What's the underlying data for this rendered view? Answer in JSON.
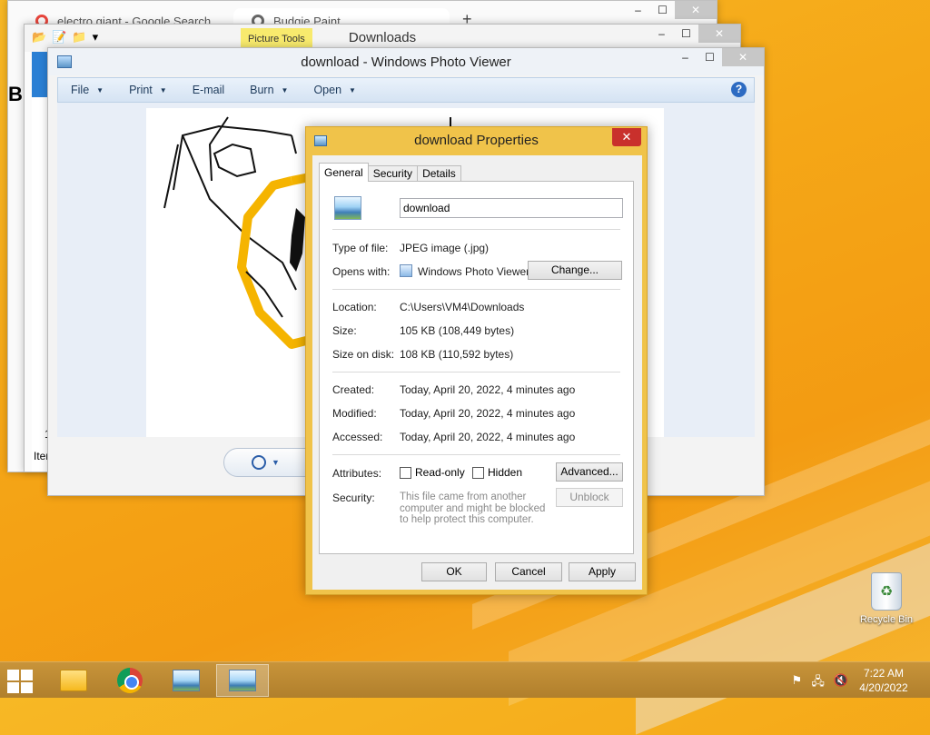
{
  "chrome": {
    "tab1": "electro giant - Google Search",
    "tab2": "Budgie Paint",
    "new_tab": "+"
  },
  "explorer": {
    "title": "Downloads",
    "context_tab": "Picture Tools",
    "left_fragments": [
      "B",
      "1",
      "Iter"
    ]
  },
  "viewer": {
    "title": "download - Windows Photo Viewer",
    "menu": [
      "File",
      "Print",
      "E-mail",
      "Burn",
      "Open"
    ],
    "help": "?"
  },
  "window_controls": {
    "minimize": "–",
    "maximize": "☐",
    "close": "✕"
  },
  "properties": {
    "title": "download Properties",
    "tabs": [
      "General",
      "Security",
      "Details"
    ],
    "filename": "download",
    "type_label": "Type of file:",
    "type_value": "JPEG image (.jpg)",
    "opens_label": "Opens with:",
    "opens_value": "Windows Photo Viewer",
    "change_button": "Change...",
    "location_label": "Location:",
    "location_value": "C:\\Users\\VM4\\Downloads",
    "size_label": "Size:",
    "size_value": "105 KB (108,449 bytes)",
    "size_disk_label": "Size on disk:",
    "size_disk_value": "108 KB (110,592 bytes)",
    "created_label": "Created:",
    "created_value": "Today, April 20, 2022, 4 minutes ago",
    "modified_label": "Modified:",
    "modified_value": "Today, April 20, 2022, 4 minutes ago",
    "accessed_label": "Accessed:",
    "accessed_value": "Today, April 20, 2022, 4 minutes ago",
    "attributes_label": "Attributes:",
    "readonly_label": "Read-only",
    "hidden_label": "Hidden",
    "advanced_button": "Advanced...",
    "security_label": "Security:",
    "security_text": "This file came from another computer and might be blocked to help protect this computer.",
    "unblock_button": "Unblock",
    "ok_button": "OK",
    "cancel_button": "Cancel",
    "apply_button": "Apply"
  },
  "desktop": {
    "recycle_bin": "Recycle Bin"
  },
  "taskbar": {
    "time": "7:22 AM",
    "date": "4/20/2022"
  },
  "colors": {
    "desktop": "#f5a717",
    "dialog_frame": "#f0c34a",
    "taskbar": "#b88530"
  }
}
